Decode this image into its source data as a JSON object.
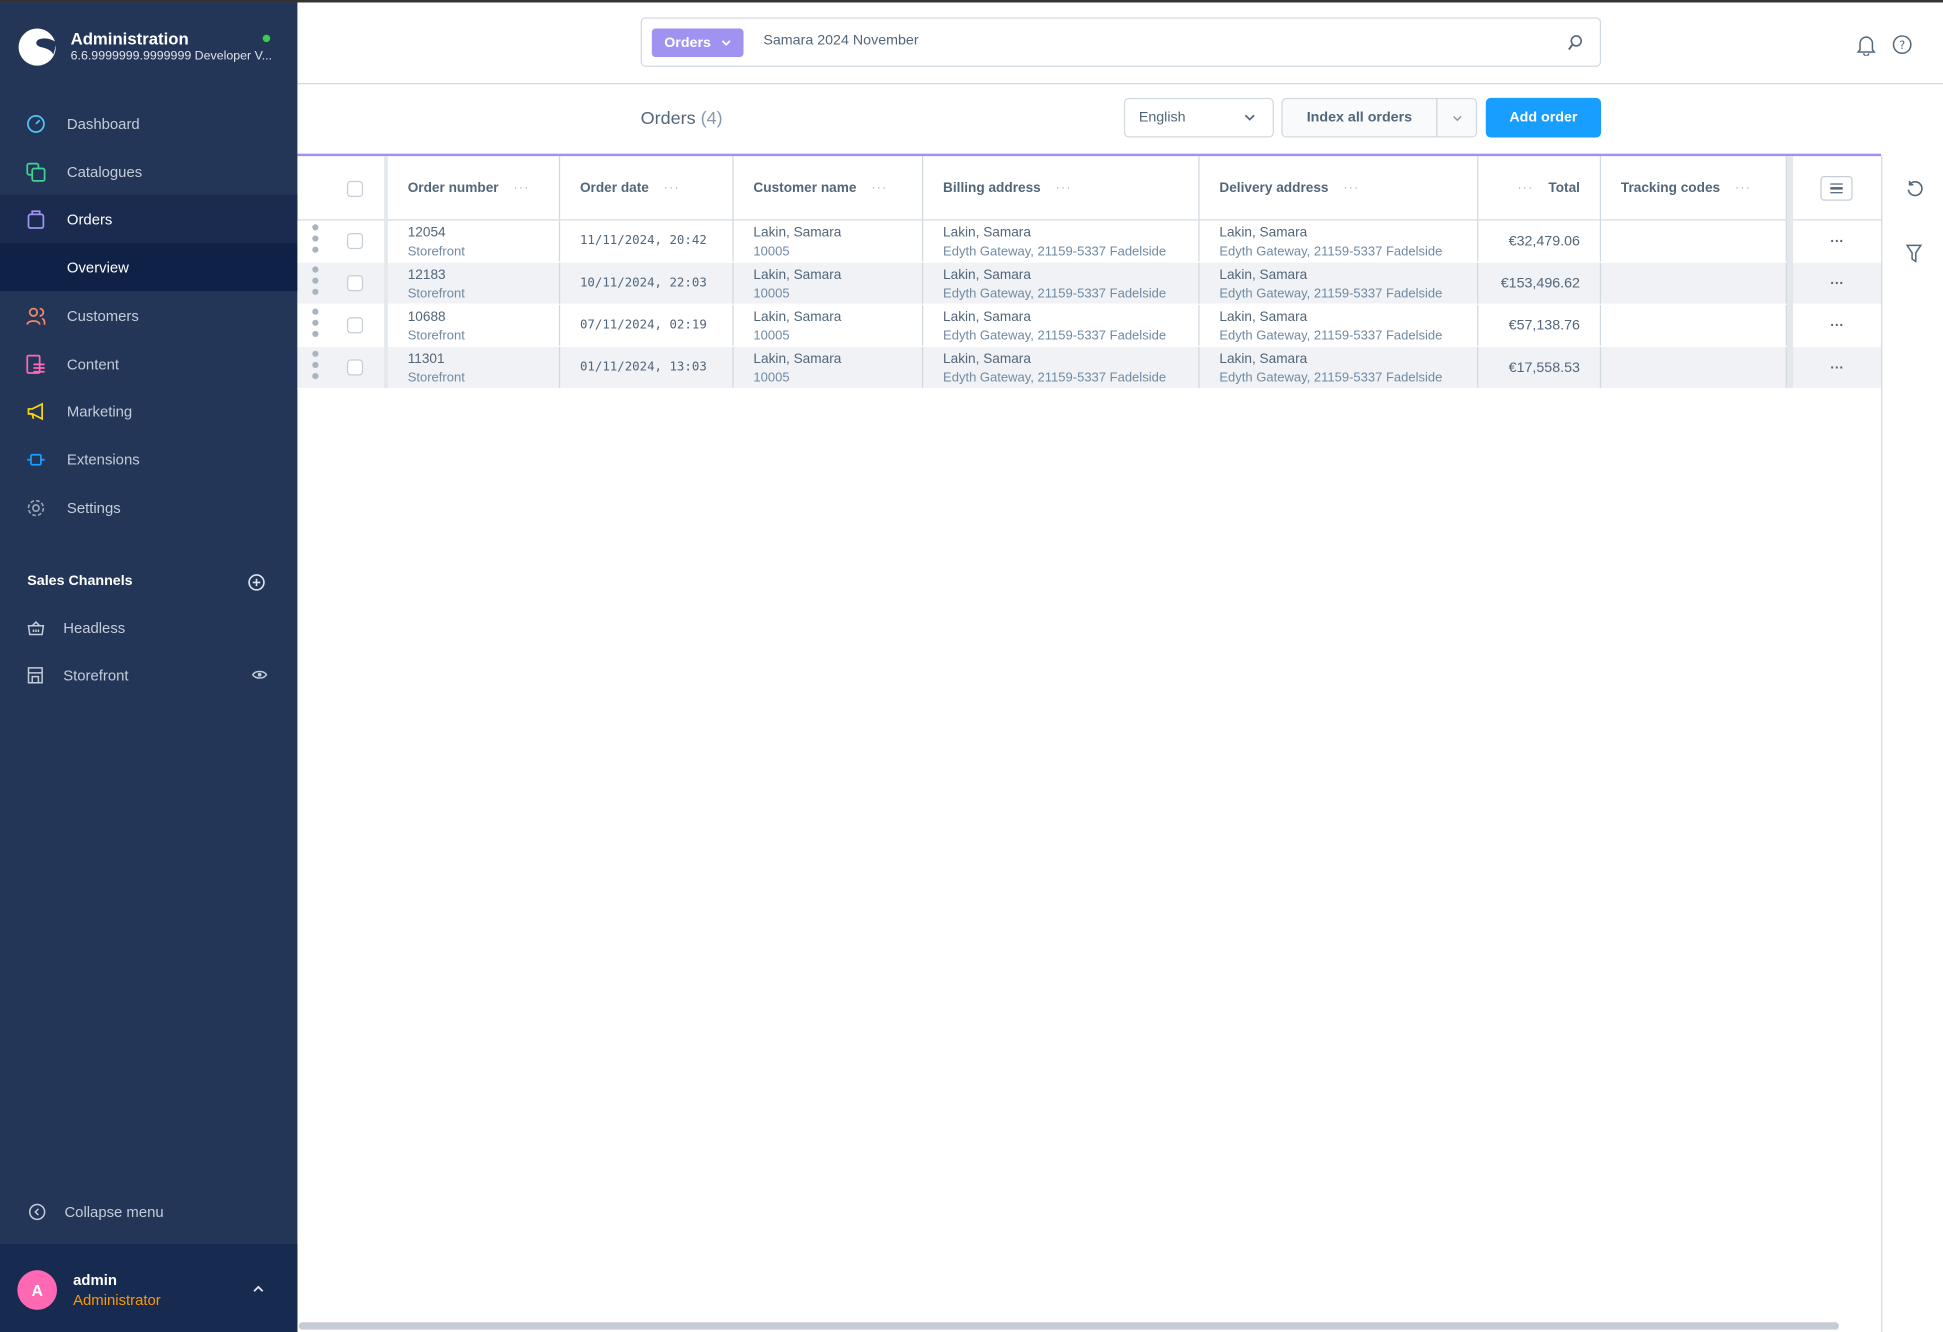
{
  "app": {
    "title": "Administration",
    "version": "6.6.9999999.9999999 Developer V...",
    "status_color": "#37d046"
  },
  "sidebar": {
    "items": [
      {
        "label": "Dashboard",
        "icon": "dashboard-icon",
        "color": "#4fc3f7"
      },
      {
        "label": "Catalogues",
        "icon": "catalogues-icon",
        "color": "#3fd394"
      },
      {
        "label": "Orders",
        "icon": "orders-icon",
        "color": "#a092f0"
      },
      {
        "label": "Overview"
      },
      {
        "label": "Customers",
        "icon": "customers-icon",
        "color": "#f88962"
      },
      {
        "label": "Content",
        "icon": "content-icon",
        "color": "#ff68b4"
      },
      {
        "label": "Marketing",
        "icon": "marketing-icon",
        "color": "#ffd700"
      },
      {
        "label": "Extensions",
        "icon": "extensions-icon",
        "color": "#189eff"
      },
      {
        "label": "Settings",
        "icon": "settings-icon",
        "color": "#9aa8b5"
      }
    ],
    "sales_channels_title": "Sales Channels",
    "channels": [
      {
        "label": "Headless"
      },
      {
        "label": "Storefront"
      }
    ],
    "collapse_label": "Collapse menu",
    "user": {
      "initial": "A",
      "name": "admin",
      "role": "Administrator"
    }
  },
  "search": {
    "type": "Orders",
    "value": "Samara 2024 November"
  },
  "page": {
    "title": "Orders",
    "count": "(4)",
    "language": "English",
    "index_label": "Index all orders",
    "add_label": "Add order",
    "accent": "#189eff"
  },
  "table": {
    "columns": [
      "Order number",
      "Order date",
      "Customer name",
      "Billing address",
      "Delivery address",
      "Total",
      "Tracking codes"
    ],
    "rows": [
      {
        "number": "12054",
        "channel": "Storefront",
        "date": "11/11/2024, 20:42",
        "customer": "Lakin, Samara",
        "customer_no": "10005",
        "billing_name": "Lakin, Samara",
        "billing_addr": "Edyth Gateway, 21159-5337 Fadelside",
        "delivery_name": "Lakin, Samara",
        "delivery_addr": "Edyth Gateway, 21159-5337 Fadelside",
        "total": "€32,479.06"
      },
      {
        "number": "12183",
        "channel": "Storefront",
        "date": "10/11/2024, 22:03",
        "customer": "Lakin, Samara",
        "customer_no": "10005",
        "billing_name": "Lakin, Samara",
        "billing_addr": "Edyth Gateway, 21159-5337 Fadelside",
        "delivery_name": "Lakin, Samara",
        "delivery_addr": "Edyth Gateway, 21159-5337 Fadelside",
        "total": "€153,496.62"
      },
      {
        "number": "10688",
        "channel": "Storefront",
        "date": "07/11/2024, 02:19",
        "customer": "Lakin, Samara",
        "customer_no": "10005",
        "billing_name": "Lakin, Samara",
        "billing_addr": "Edyth Gateway, 21159-5337 Fadelside",
        "delivery_name": "Lakin, Samara",
        "delivery_addr": "Edyth Gateway, 21159-5337 Fadelside",
        "total": "€57,138.76"
      },
      {
        "number": "11301",
        "channel": "Storefront",
        "date": "01/11/2024, 13:03",
        "customer": "Lakin, Samara",
        "customer_no": "10005",
        "billing_name": "Lakin, Samara",
        "billing_addr": "Edyth Gateway, 21159-5337 Fadelside",
        "delivery_name": "Lakin, Samara",
        "delivery_addr": "Edyth Gateway, 21159-5337 Fadelside",
        "total": "€17,558.53"
      }
    ]
  }
}
